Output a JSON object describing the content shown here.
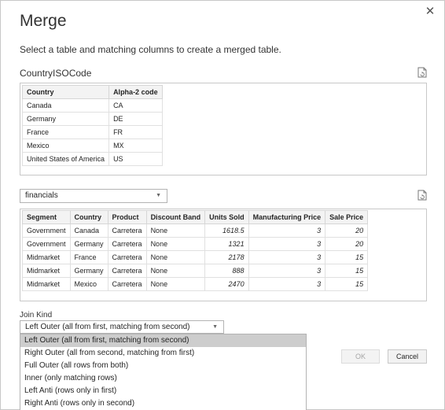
{
  "dialog": {
    "title": "Merge",
    "subtitle": "Select a table and matching columns to create a merged table.",
    "close_icon": "close-icon",
    "refresh_icon": "refresh-icon"
  },
  "first_table": {
    "name": "CountryISOCode",
    "columns": [
      "Country",
      "Alpha-2 code"
    ],
    "rows": [
      [
        "Canada",
        "CA"
      ],
      [
        "Germany",
        "DE"
      ],
      [
        "France",
        "FR"
      ],
      [
        "Mexico",
        "MX"
      ],
      [
        "United States of America",
        "US"
      ]
    ]
  },
  "second_table": {
    "selected": "financials",
    "columns": [
      "Segment",
      "Country",
      "Product",
      "Discount Band",
      "Units Sold",
      "Manufacturing Price",
      "Sale Price"
    ],
    "rows": [
      [
        "Government",
        "Canada",
        "Carretera",
        "None",
        "1618.5",
        "3",
        "20"
      ],
      [
        "Government",
        "Germany",
        "Carretera",
        "None",
        "1321",
        "3",
        "20"
      ],
      [
        "Midmarket",
        "France",
        "Carretera",
        "None",
        "2178",
        "3",
        "15"
      ],
      [
        "Midmarket",
        "Germany",
        "Carretera",
        "None",
        "888",
        "3",
        "15"
      ],
      [
        "Midmarket",
        "Mexico",
        "Carretera",
        "None",
        "2470",
        "3",
        "15"
      ]
    ],
    "numeric_columns": [
      4,
      5,
      6
    ]
  },
  "join": {
    "label": "Join Kind",
    "selected": "Left Outer (all from first, matching from second)",
    "options": [
      "Left Outer (all from first, matching from second)",
      "Right Outer (all from second, matching from first)",
      "Full Outer (all rows from both)",
      "Inner (only matching rows)",
      "Left Anti (rows only in first)",
      "Right Anti (rows only in second)"
    ],
    "highlighted_index": 0
  },
  "buttons": {
    "ok": "OK",
    "cancel": "Cancel"
  }
}
